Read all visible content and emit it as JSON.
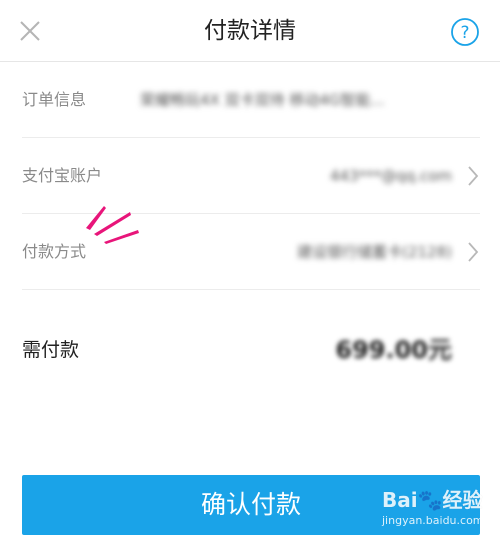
{
  "header": {
    "title": "付款详情",
    "close_icon": "close-icon",
    "help_icon": "help-icon"
  },
  "rows": [
    {
      "label": "订单信息",
      "value": "荣耀畅玩4X 双卡双待 移动4G智能..."
    },
    {
      "label": "支付宝账户",
      "value": "443***@qq.com"
    },
    {
      "label": "付款方式",
      "value": "建设银行储蓄卡(2128)"
    }
  ],
  "payment": {
    "label": "需付款",
    "amount": "699.00元"
  },
  "confirm": {
    "label": "确认付款"
  },
  "watermark": {
    "logo_a": "Bai",
    "logo_b": "经验",
    "url": "jingyan.baidu.com"
  },
  "colors": {
    "accent": "#1aa3e8",
    "highlight": "#e8157a"
  }
}
